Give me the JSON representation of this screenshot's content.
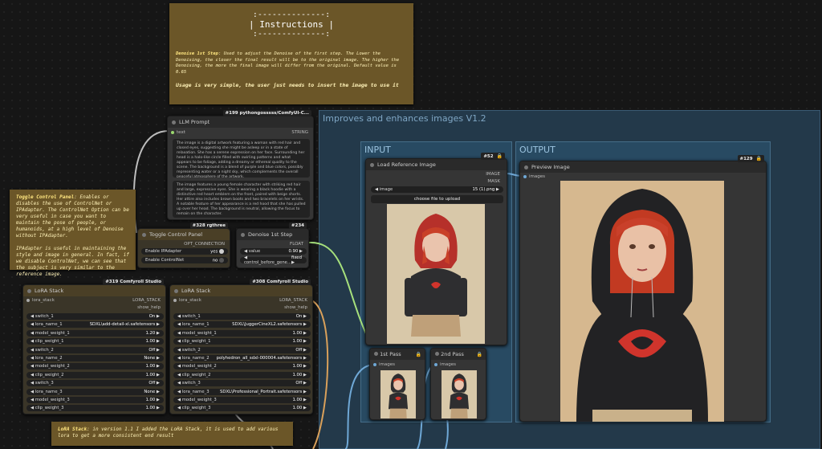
{
  "instructions": {
    "banner": [
      ":--------------:",
      "| Instructions |",
      ":--------------:"
    ],
    "denoise_label": "Denoise 1st Step",
    "denoise_text": ": Used to adjust the Denoise of the first step. The Lower the Denoising, the closer the final result will be to the original image. The higher the Denoising, the more the final image will differ from the original. Default value is 0.65",
    "usage": "Usage is very simple, the user just needs to insert the image to use it"
  },
  "toggle_note": {
    "label": "Toggle Control Panel",
    "text": ": Enables or disables the use of ControlNet or IPAdapter. The ControlNet Option can be very useful in case you want to maintain the pose of people, or humanoids, at a high level of Denoise without IPAdapter.",
    "text2": "IPAdapter is useful in maintaining the style and image in general. In fact, if we disable ControlNet, we can see that the subject is very similar to the reference image."
  },
  "lora_note": {
    "label": "LoRA Stack",
    "text": ": in version 1.1 I added the LoRA Stack, it is used to add various lora to get a more consistent end result"
  },
  "groups": {
    "main_title": "Improves and enhances images V1.2",
    "input_title": "INPUT",
    "output_title": "OUTPUT"
  },
  "llm_node": {
    "tag": "#199 pythongosssss/ComfyUI-C...",
    "title": "LLM Prompt",
    "input_label": "text",
    "output_label": "STRING",
    "text1": "The image is a digital artwork featuring a woman with red hair and closed eyes, suggesting she might be asleep or in a state of relaxation. She has a serene expression on her face. Surrounding her head is a halo-like circle filled with swirling patterns and what appears to be foliage, adding a dreamy or ethereal quality to the scene. The background is a blend of purple and blue colors, possibly representing water or a night sky, which complements the overall peaceful atmosphere of the artwork.",
    "text2": "The image features a young female character with striking red hair and large, expressive eyes. She is wearing a black hoodie with a distinctive red heart emblem on the front, paired with beige shorts. Her attire also includes brown boots and two bracelets on her wrists. A notable feature of her appearance is a red hood that she has pulled up over her head. The background is neutral, allowing the focus to remain on the character."
  },
  "toggle_node": {
    "tag": "#328 rgthree",
    "title": "Toggle Control Panel",
    "output_label": "OPT_CONNECTION",
    "rows": [
      {
        "label": "Enable IPAdapter",
        "value": "yes"
      },
      {
        "label": "Enable ControlNet",
        "value": "no"
      }
    ]
  },
  "denoise_node": {
    "tag": "#234",
    "title": "Denoise 1st Step",
    "output_label": "FLOAT",
    "rows": [
      {
        "label": "value",
        "value": "0.90"
      },
      {
        "label": "control_before_gene...",
        "value": "fixed"
      }
    ]
  },
  "lora1": {
    "tag": "#319 Comfyroll Studio",
    "title": "LoRA Stack",
    "input_label": "lora_stack",
    "output_label": "LORA_STACK",
    "help_label": "show_help",
    "rows": [
      {
        "label": "switch_1",
        "value": "On"
      },
      {
        "label": "lora_name_1",
        "value": "SDXL\\add-detail-xl.safetensors"
      },
      {
        "label": "model_weight_1",
        "value": "1.20"
      },
      {
        "label": "clip_weight_1",
        "value": "1.00"
      },
      {
        "label": "switch_2",
        "value": "Off"
      },
      {
        "label": "lora_name_2",
        "value": "None"
      },
      {
        "label": "model_weight_2",
        "value": "1.00"
      },
      {
        "label": "clip_weight_2",
        "value": "1.00"
      },
      {
        "label": "switch_3",
        "value": "Off"
      },
      {
        "label": "lora_name_3",
        "value": "None"
      },
      {
        "label": "model_weight_3",
        "value": "1.00"
      },
      {
        "label": "clip_weight_3",
        "value": "1.00"
      }
    ]
  },
  "lora2": {
    "tag": "#308 Comfyroll Studio",
    "title": "LoRA Stack",
    "input_label": "lora_stack",
    "output_label": "LORA_STACK",
    "help_label": "show_help",
    "rows": [
      {
        "label": "switch_1",
        "value": "On"
      },
      {
        "label": "lora_name_1",
        "value": "SDXL\\JuggerCineXL2.safetensors"
      },
      {
        "label": "model_weight_1",
        "value": "1.00"
      },
      {
        "label": "clip_weight_1",
        "value": "1.00"
      },
      {
        "label": "switch_2",
        "value": "Off"
      },
      {
        "label": "lora_name_2",
        "value": "polyhedron_all_sdxl-000004.safetensors"
      },
      {
        "label": "model_weight_2",
        "value": "1.00"
      },
      {
        "label": "clip_weight_2",
        "value": "1.00"
      },
      {
        "label": "switch_3",
        "value": "Off"
      },
      {
        "label": "lora_name_3",
        "value": "SDXL\\Professional_Portrait.safetensors"
      },
      {
        "label": "model_weight_3",
        "value": "1.00"
      },
      {
        "label": "clip_weight_3",
        "value": "1.00"
      }
    ]
  },
  "load_node": {
    "tag": "#52",
    "title": "Load Reference Image",
    "outputs": [
      "IMAGE",
      "MASK"
    ],
    "image_label": "image",
    "image_value": "15 (1).png",
    "upload_label": "choose file to upload"
  },
  "preview_node": {
    "tag": "#129",
    "title": "Preview Image",
    "input_label": "images"
  },
  "pass1_node": {
    "title": "1st Pass",
    "input_label": "images"
  },
  "pass2_node": {
    "title": "2nd Pass",
    "input_label": "images"
  },
  "colors": {
    "wire_image": "#6fa8d6",
    "wire_float": "#9bd96f",
    "wire_string": "#c0c0c0",
    "hoodie_heart": "#d0342c",
    "hair": "#c9402a"
  }
}
